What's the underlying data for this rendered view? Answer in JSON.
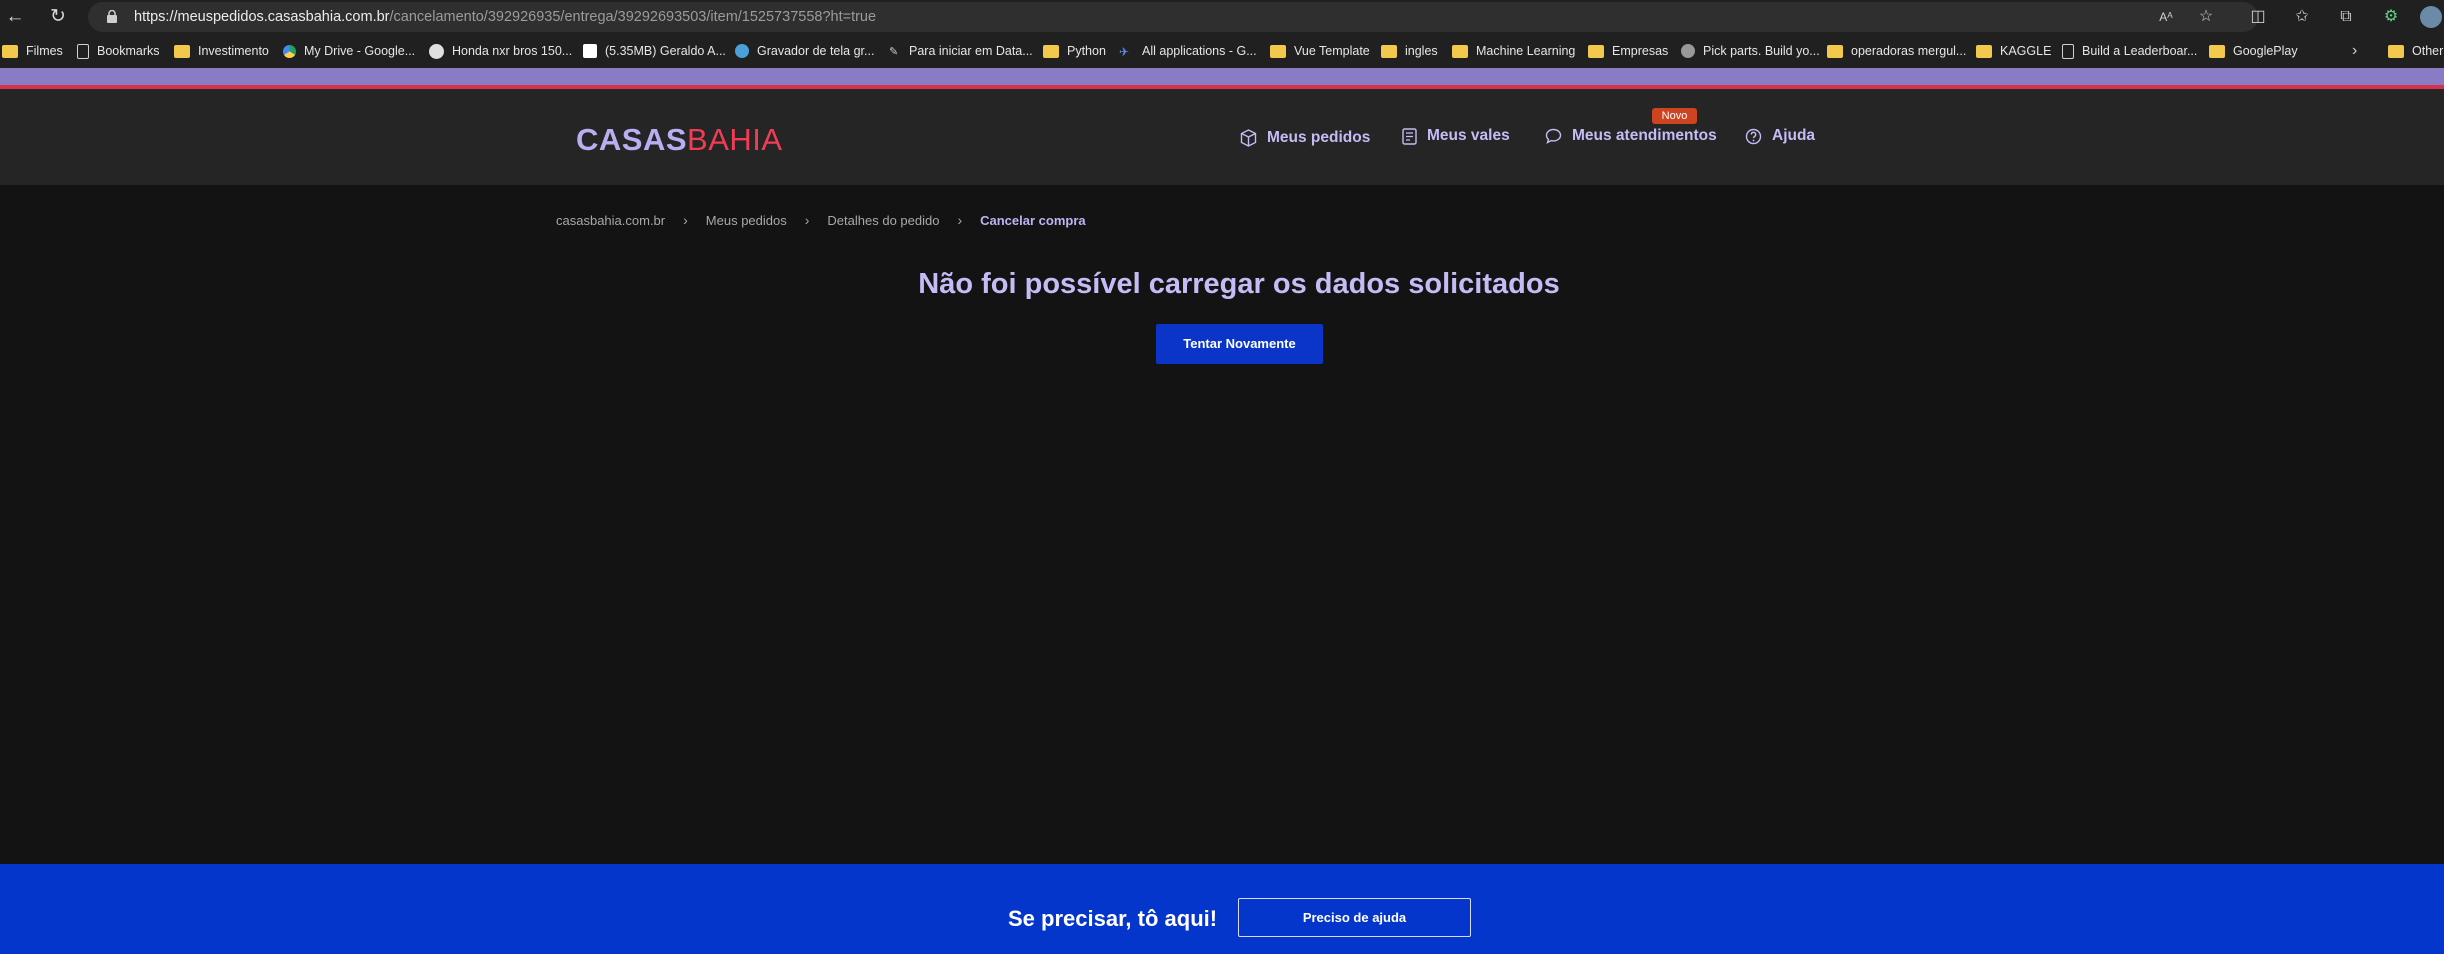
{
  "browser": {
    "url_host": "https://meuspedidos.casasbahia.com.br",
    "url_path": "/cancelamento/392926935/entrega/39292693503/item/1525737558?ht=true",
    "bookmarks": [
      {
        "label": "Filmes",
        "icon": "folder-icon"
      },
      {
        "label": "Bookmarks",
        "icon": "page-icon"
      },
      {
        "label": "Investimento",
        "icon": "folder-icon"
      },
      {
        "label": "My Drive - Google...",
        "icon": "drive-icon"
      },
      {
        "label": "Honda nxr bros 150...",
        "icon": "site-icon"
      },
      {
        "label": "(5.35MB) Geraldo A...",
        "icon": "site-icon"
      },
      {
        "label": "Gravador de tela gr...",
        "icon": "site-icon"
      },
      {
        "label": "Para iniciar em Data...",
        "icon": "site-icon"
      },
      {
        "label": "Python",
        "icon": "folder-icon"
      },
      {
        "label": "All applications - G...",
        "icon": "site-icon"
      },
      {
        "label": "Vue Template",
        "icon": "folder-icon"
      },
      {
        "label": "ingles",
        "icon": "folder-icon"
      },
      {
        "label": "Machine Learning",
        "icon": "folder-icon"
      },
      {
        "label": "Empresas",
        "icon": "folder-icon"
      },
      {
        "label": "Pick parts. Build yo...",
        "icon": "site-icon"
      },
      {
        "label": "operadoras mergul...",
        "icon": "folder-icon"
      },
      {
        "label": "KAGGLE",
        "icon": "folder-icon"
      },
      {
        "label": "Build a Leaderboar...",
        "icon": "page-icon"
      },
      {
        "label": "GooglePlay",
        "icon": "folder-icon"
      },
      {
        "label": "Other",
        "icon": "folder-icon"
      }
    ]
  },
  "header": {
    "logo_part1": "CASAS",
    "logo_part2": "BAHIA",
    "nav": {
      "pedidos": "Meus pedidos",
      "vales": "Meus vales",
      "atendimentos": "Meus atendimentos",
      "ajuda": "Ajuda"
    },
    "badge": "Novo"
  },
  "breadcrumb": {
    "home": "casasbahia.com.br",
    "pedidos": "Meus pedidos",
    "detalhes": "Detalhes do pedido",
    "current": "Cancelar compra"
  },
  "main": {
    "error_title": "Não foi possível carregar os dados solicitados",
    "retry_label": "Tentar Novamente"
  },
  "footer": {
    "help_text": "Se precisar, tô aqui!",
    "help_button": "Preciso de ajuda"
  },
  "colors": {
    "accent": "#c6bbf5",
    "brand_red": "#ee3d55",
    "primary_blue": "#0a35c8"
  }
}
